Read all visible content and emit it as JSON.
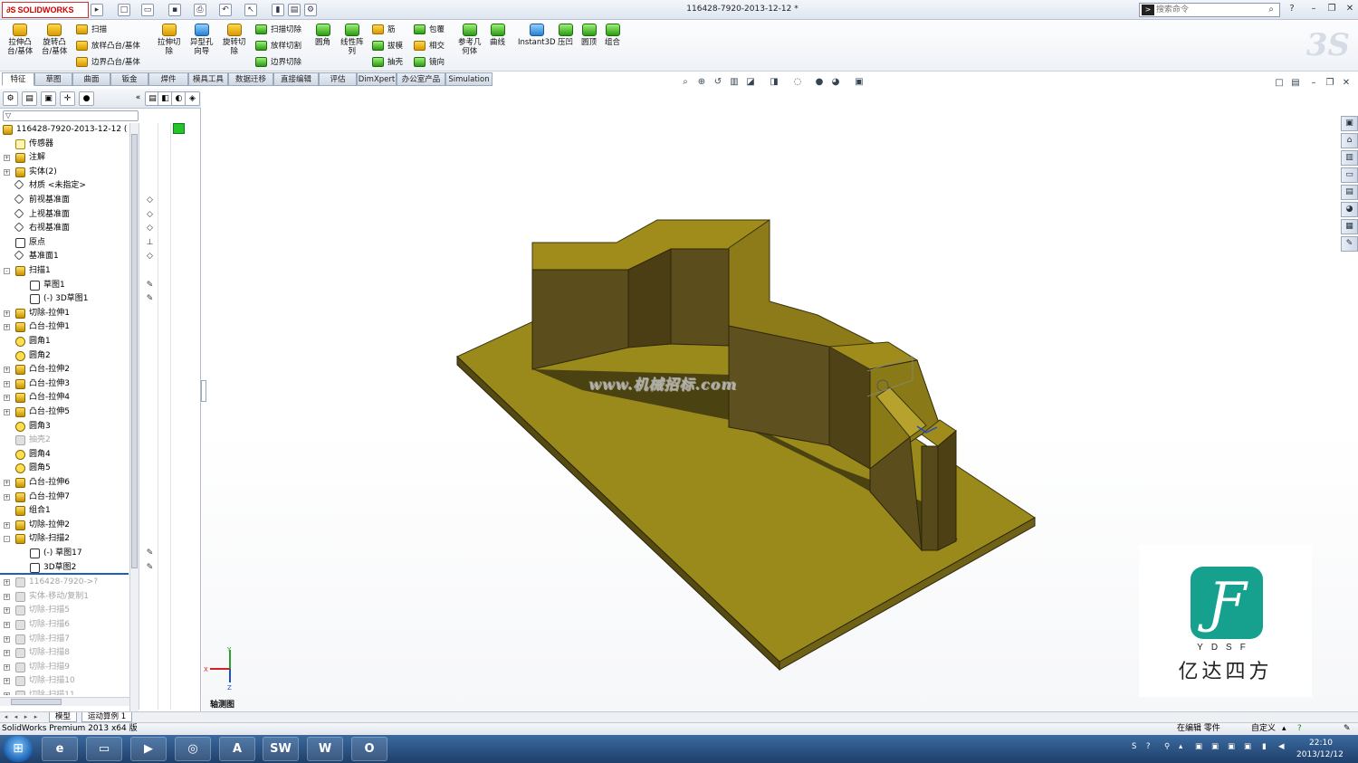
{
  "app": {
    "logo_text": "SOLIDWORKS",
    "document_title": "116428-7920-2013-12-12 *",
    "search_placeholder": "搜索命令"
  },
  "ribbon": {
    "big_buttons": [
      {
        "label": "拉伸凸\n台/基体",
        "icon": "extruded-boss-icon"
      },
      {
        "label": "旋转凸\n台/基体",
        "icon": "revolved-boss-icon"
      },
      {
        "label": "拉伸切\n除",
        "icon": "extruded-cut-icon"
      },
      {
        "label": "异型孔\n向导",
        "icon": "hole-wizard-icon"
      },
      {
        "label": "旋转切\n除",
        "icon": "revolved-cut-icon"
      },
      {
        "label": "圆角",
        "icon": "fillet-icon"
      },
      {
        "label": "线性阵\n列",
        "icon": "linear-pattern-icon"
      },
      {
        "label": "参考几\n何体",
        "icon": "reference-geometry-icon"
      },
      {
        "label": "曲线",
        "icon": "curves-icon"
      },
      {
        "label": "Instant3D",
        "icon": "instant3d-icon"
      },
      {
        "label": "压凹",
        "icon": "indent-icon"
      },
      {
        "label": "圆顶",
        "icon": "dome-icon"
      },
      {
        "label": "组合",
        "icon": "combine-icon"
      }
    ],
    "small_buttons": [
      {
        "label": "扫描",
        "icon": "sweep-icon"
      },
      {
        "label": "放样凸台/基体",
        "icon": "loft-icon"
      },
      {
        "label": "边界凸台/基体",
        "icon": "boundary-boss-icon"
      },
      {
        "label": "扫描切除",
        "icon": "swept-cut-icon"
      },
      {
        "label": "放样切割",
        "icon": "lofted-cut-icon"
      },
      {
        "label": "边界切除",
        "icon": "boundary-cut-icon"
      },
      {
        "label": "筋",
        "icon": "rib-icon"
      },
      {
        "label": "拔模",
        "icon": "draft-icon"
      },
      {
        "label": "抽壳",
        "icon": "shell-icon"
      },
      {
        "label": "包覆",
        "icon": "wrap-icon"
      },
      {
        "label": "相交",
        "icon": "intersect-icon"
      },
      {
        "label": "镜向",
        "icon": "mirror-icon"
      }
    ]
  },
  "tabs": [
    "特征",
    "草图",
    "曲面",
    "钣金",
    "焊件",
    "模具工具",
    "数据迁移",
    "直接编辑",
    "评估",
    "DimXpert",
    "办公室产品",
    "Simulation"
  ],
  "tree": {
    "root": "116428-7920-2013-12-12  (",
    "nodes": [
      {
        "label": "传感器",
        "icon": "sensor",
        "expand": "",
        "indent": 0
      },
      {
        "label": "注解",
        "icon": "annotation",
        "expand": "+",
        "indent": 0
      },
      {
        "label": "实体(2)",
        "icon": "solid-bodies",
        "expand": "+",
        "indent": 0
      },
      {
        "label": "材质 <未指定>",
        "icon": "material",
        "expand": "",
        "indent": 0
      },
      {
        "label": "前视基准面",
        "icon": "plane",
        "expand": "",
        "indent": 0
      },
      {
        "label": "上视基准面",
        "icon": "plane",
        "expand": "",
        "indent": 0
      },
      {
        "label": "右视基准面",
        "icon": "plane",
        "expand": "",
        "indent": 0
      },
      {
        "label": "原点",
        "icon": "origin",
        "expand": "",
        "indent": 0
      },
      {
        "label": "基准面1",
        "icon": "plane",
        "expand": "",
        "indent": 0
      },
      {
        "label": "扫描1",
        "icon": "feature",
        "expand": "-",
        "indent": 0
      },
      {
        "label": "草图1",
        "icon": "sketch",
        "expand": "",
        "indent": 1
      },
      {
        "label": "(-) 3D草图1",
        "icon": "sketch",
        "expand": "",
        "indent": 1
      },
      {
        "label": "切除-拉伸1",
        "icon": "feature",
        "expand": "+",
        "indent": 0
      },
      {
        "label": "凸台-拉伸1",
        "icon": "feature",
        "expand": "+",
        "indent": 0
      },
      {
        "label": "圆角1",
        "icon": "fillet",
        "expand": "",
        "indent": 0
      },
      {
        "label": "圆角2",
        "icon": "fillet",
        "expand": "",
        "indent": 0
      },
      {
        "label": "凸台-拉伸2",
        "icon": "feature",
        "expand": "+",
        "indent": 0
      },
      {
        "label": "凸台-拉伸3",
        "icon": "feature",
        "expand": "+",
        "indent": 0
      },
      {
        "label": "凸台-拉伸4",
        "icon": "feature",
        "expand": "+",
        "indent": 0
      },
      {
        "label": "凸台-拉伸5",
        "icon": "feature",
        "expand": "+",
        "indent": 0
      },
      {
        "label": "圆角3",
        "icon": "fillet",
        "expand": "",
        "indent": 0
      },
      {
        "label": "抽壳2",
        "icon": "grey",
        "expand": "",
        "indent": 0,
        "suppressed": true
      },
      {
        "label": "圆角4",
        "icon": "fillet",
        "expand": "",
        "indent": 0
      },
      {
        "label": "圆角5",
        "icon": "fillet",
        "expand": "",
        "indent": 0
      },
      {
        "label": "凸台-拉伸6",
        "icon": "feature",
        "expand": "+",
        "indent": 0
      },
      {
        "label": "凸台-拉伸7",
        "icon": "feature",
        "expand": "+",
        "indent": 0
      },
      {
        "label": "组合1",
        "icon": "feature",
        "expand": "",
        "indent": 0
      },
      {
        "label": "切除-拉伸2",
        "icon": "feature",
        "expand": "+",
        "indent": 0
      },
      {
        "label": "切除-扫描2",
        "icon": "feature",
        "expand": "-",
        "indent": 0
      },
      {
        "label": "(-) 草图17",
        "icon": "sketch",
        "expand": "",
        "indent": 1
      },
      {
        "label": "3D草图2",
        "icon": "sketch",
        "expand": "",
        "indent": 1
      }
    ],
    "rolled_back": [
      "116428-7920->?",
      "实体-移动/复制1",
      "切除-扫描5",
      "切除-扫描6",
      "切除-扫描7",
      "切除-扫描8",
      "切除-扫描9",
      "切除-扫描10",
      "切除-扫描11"
    ]
  },
  "viewport": {
    "view_name": "轴测图",
    "site_watermark": "www.机械招标.com",
    "brand_letters": "YDSF",
    "brand_name": "亿达四方",
    "triad": {
      "x": "X",
      "y": "Y",
      "z": "Z"
    }
  },
  "sheet_tabs": [
    "模型",
    "运动算例 1"
  ],
  "status": {
    "product": "SolidWorks Premium 2013 x64 版",
    "mode": "在编辑 零件",
    "units": "自定义"
  },
  "taskbar": {
    "apps": [
      "ie-icon",
      "explorer-icon",
      "media-player-icon",
      "chrome-icon",
      "acrobat-icon",
      "solidworks-icon",
      "word-icon",
      "outlook-icon"
    ],
    "time": "22:10",
    "date": "2013/12/12"
  },
  "colors": {
    "model_face_top": "#9a8a1c",
    "model_face_side": "#5c4d1d",
    "brand_green": "#16a08e"
  }
}
